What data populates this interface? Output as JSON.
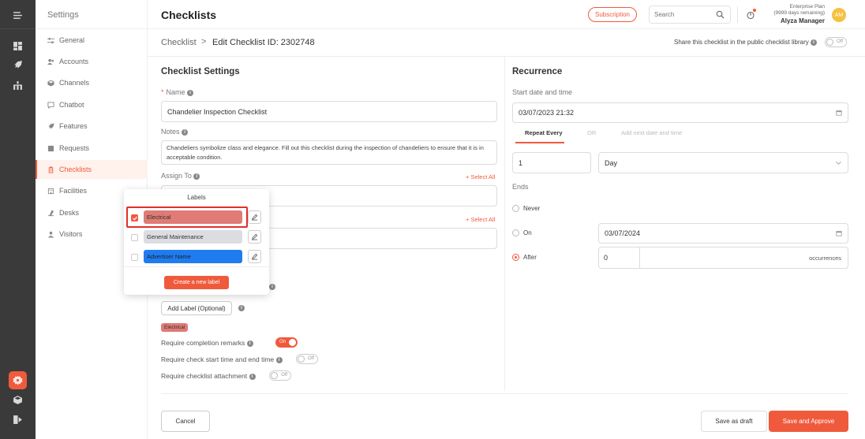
{
  "rail": {
    "icons": [
      "menu-toggle-icon",
      "dashboard-icon",
      "rocket-icon",
      "hierarchy-icon",
      "settings-icon",
      "cube-icon",
      "logout-icon"
    ]
  },
  "sidebar": {
    "title": "Settings",
    "items": [
      {
        "label": "General",
        "icon": "sliders-icon"
      },
      {
        "label": "Accounts",
        "icon": "users-icon"
      },
      {
        "label": "Channels",
        "icon": "cube-icon"
      },
      {
        "label": "Chatbot",
        "icon": "chat-icon"
      },
      {
        "label": "Features",
        "icon": "rocket-icon"
      },
      {
        "label": "Requests",
        "icon": "inbox-icon"
      },
      {
        "label": "Checklists",
        "icon": "clipboard-icon",
        "active": true
      },
      {
        "label": "Facilities",
        "icon": "building-icon"
      },
      {
        "label": "Desks",
        "icon": "desk-icon"
      },
      {
        "label": "Visitors",
        "icon": "visitors-icon"
      }
    ]
  },
  "header": {
    "title": "Checklists",
    "subscription_label": "Subscription",
    "search_placeholder": "Search",
    "plan_name": "Enterprise Plan",
    "plan_remaining": "(9999 days remaining)",
    "user_name": "Alyza Manager",
    "avatar_initials": "AM"
  },
  "breadcrumb": {
    "root": "Checklist",
    "separator": ">",
    "current": "Edit Checklist ID: 2302748",
    "share_label": "Share this checklist in the public checklist library",
    "share_toggle": "Off"
  },
  "settings": {
    "heading": "Checklist Settings",
    "name_label": "Name",
    "name_value": "Chandelier Inspection Checklist",
    "notes_label": "Notes",
    "notes_value": "Chandeliers symbolize class and elegance. Fill out this checklist during the inspection of chandeliers to ensure that it is in acceptable condition.",
    "assign_label": "Assign To",
    "select_all_1": "+ Select All",
    "select_all_2": "+ Select All",
    "add_label_button": "Add Label (Optional)",
    "selected_label_chip": "Electrical",
    "remarks_label": "Require completion remarks",
    "remarks_toggle": "On",
    "time_label": "Require check start time and end time",
    "time_toggle": "Off",
    "attach_label": "Require checklist attachment",
    "attach_toggle": "Off"
  },
  "recurrence": {
    "heading": "Recurrence",
    "start_label": "Start date and time",
    "start_value": "03/07/2023 21:32",
    "tab_repeat": "Repeat Every",
    "tab_or": "OR",
    "tab_next": "Add next date and time",
    "interval_value": "1",
    "unit_value": "Day",
    "ends_label": "Ends",
    "never_label": "Never",
    "on_label": "On",
    "on_date_value": "03/07/2024",
    "after_label": "After",
    "after_value": "0",
    "occurrences_label": "occurrences",
    "selected_end": "After"
  },
  "labels_popover": {
    "title": "Labels",
    "items": [
      {
        "name": "Electrical",
        "color": "#e07b75",
        "checked": true
      },
      {
        "name": "General Maintenance",
        "color": "#dcdde3",
        "checked": false
      },
      {
        "name": "Advertiser Name",
        "color": "#1f7cf0",
        "checked": false
      }
    ],
    "create_button": "Create a new label"
  },
  "footer": {
    "cancel_label": "Cancel",
    "draft_label": "Save as draft",
    "approve_label": "Save and Approve"
  },
  "colors": {
    "accent": "#f05a3c",
    "rail": "#3a3a3a"
  }
}
